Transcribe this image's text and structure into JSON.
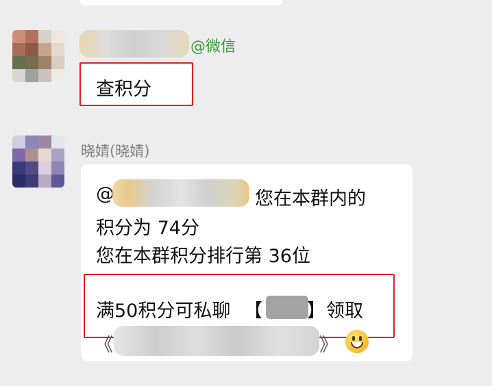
{
  "chat": {
    "messages": [
      {
        "sender_tag": "@微信",
        "text": "查积分"
      },
      {
        "sender_name": "晓婧(晓婧)",
        "mention_prefix": "@",
        "lines": [
          "您在本群内的",
          "积分为 74分",
          "您在本群积分排行第 36位"
        ],
        "reward_prefix": "满50积分可私聊",
        "reward_bracket_open": "【",
        "reward_bracket_close": "】",
        "reward_suffix": "领取",
        "link_open": "《",
        "link_close": "》",
        "emoji": "grinning-face-emoji"
      }
    ]
  },
  "colors": {
    "background": "#ededed",
    "bubble": "#ffffff",
    "highlight_box": "#e02020",
    "sender_tag": "#3a9a3a",
    "sender_name": "#7d7d7d"
  }
}
